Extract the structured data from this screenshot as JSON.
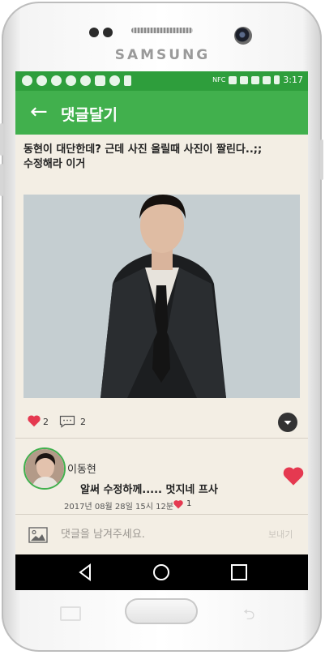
{
  "device": {
    "brand": "SAMSUNG"
  },
  "status_bar": {
    "time": "3:17",
    "nfc": "NFC"
  },
  "app_bar": {
    "back_glyph": "←",
    "title": "댓글달기"
  },
  "post": {
    "text_line1": "동현이 대단한데? 근데 사진 올릴때 사진이 짤린다..;;",
    "text_line2": "수정해라 이거",
    "like_count": "2",
    "comment_count": "2"
  },
  "comment": {
    "author": "이동현",
    "text": "알써 수정하께..... 멋지네 프사",
    "timestamp": "2017년 08월 28일 15시 12분",
    "like_count": "1"
  },
  "composer": {
    "placeholder": "댓글을 남겨주세요.",
    "send_label": "보내기"
  },
  "colors": {
    "accent": "#41b04d",
    "status_bar": "#2e9e3c",
    "heart": "#e53950",
    "background": "#f3eee4"
  },
  "icons": [
    "arrow-back-icon",
    "heart-icon",
    "comment-icon",
    "menu-down-icon",
    "image-icon",
    "nav-back-icon",
    "nav-home-icon",
    "nav-recents-icon"
  ]
}
